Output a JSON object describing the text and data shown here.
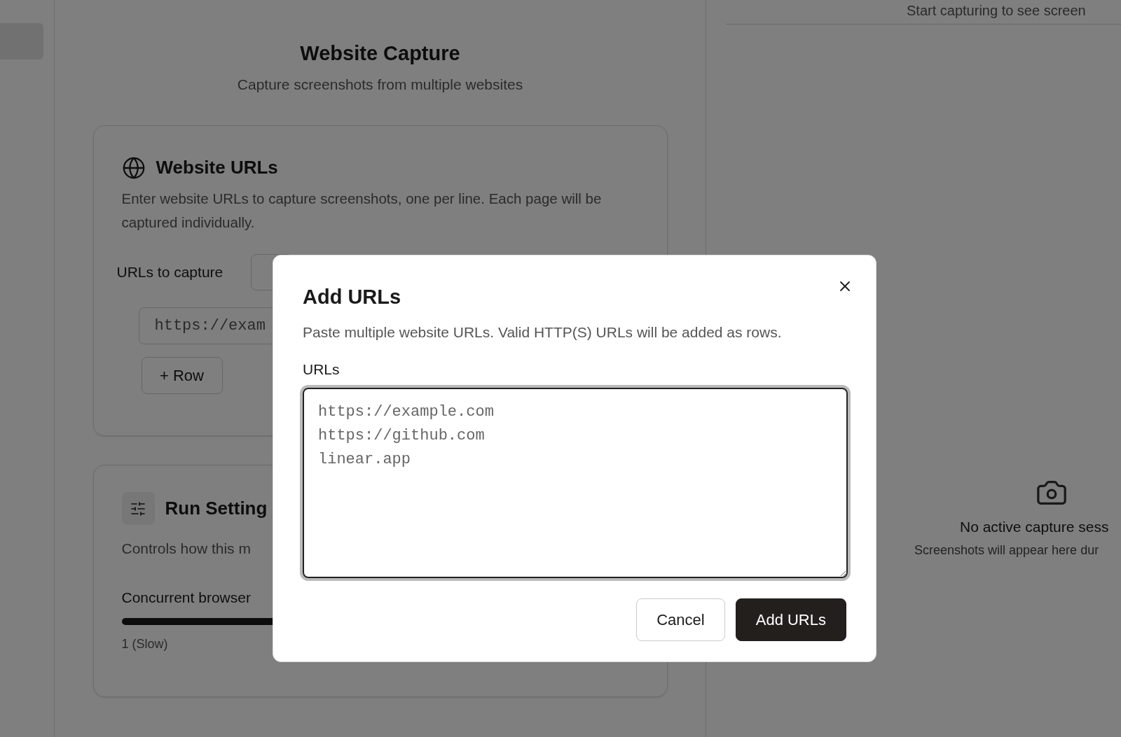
{
  "page": {
    "title": "Website Capture",
    "subtitle": "Capture screenshots from multiple websites"
  },
  "urls_card": {
    "title": "Website URLs",
    "description": "Enter website URLs to capture screenshots, one per line. Each page will be captured individually.",
    "field_label": "URLs to capture",
    "url_placeholder": "https://exam",
    "add_row_button": "+ Row"
  },
  "settings_card": {
    "title": "Run Setting",
    "description": "Controls how this m",
    "slider_label": "Concurrent browser",
    "slider_reading": "1 (Slow)"
  },
  "preview": {
    "header": "Start capturing to see screen",
    "empty_title": "No active capture sess",
    "empty_text": "Screenshots will appear here dur"
  },
  "dialog": {
    "title": "Add URLs",
    "description": "Paste multiple website URLs. Valid HTTP(S) URLs will be added as rows.",
    "field_label": "URLs",
    "placeholder": "https://example.com\nhttps://github.com\nlinear.app",
    "buttons": [
      {
        "label": "Cancel",
        "kind": "secondary"
      },
      {
        "label": "Add URLs",
        "kind": "primary"
      }
    ]
  }
}
